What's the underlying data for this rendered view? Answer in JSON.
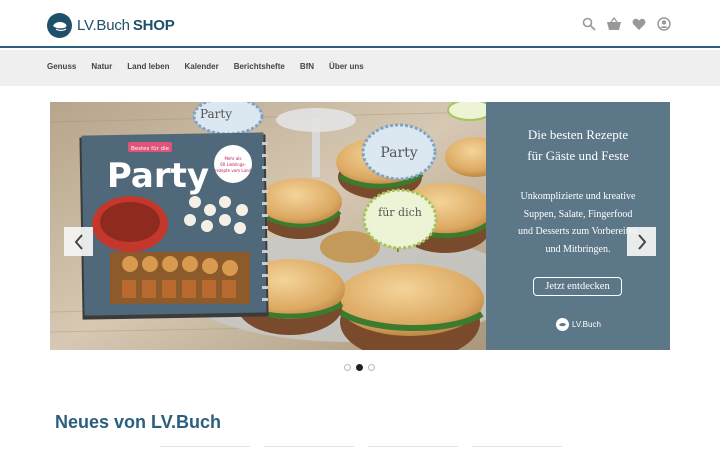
{
  "header": {
    "logo_main": "LV.Buch",
    "logo_shop": "SHOP",
    "icons": [
      "search-icon",
      "basket-icon",
      "heart-icon",
      "account-icon"
    ]
  },
  "nav": {
    "items": [
      {
        "label": "Genuss"
      },
      {
        "label": "Natur"
      },
      {
        "label": "Land leben"
      },
      {
        "label": "Kalender"
      },
      {
        "label": "Berichtshefte"
      },
      {
        "label": "BfN"
      },
      {
        "label": "Über uns"
      }
    ]
  },
  "hero": {
    "book_small_title": "Bestes für die",
    "book_title": "Party",
    "book_badge": "Mehr als 60 Lieblingsrezepte vom Land",
    "flag_1": "Party",
    "flag_2": "Party",
    "flag_3": "für dich",
    "title_line1": "Die besten Rezepte",
    "title_line2": "für Gäste und Feste",
    "text_line1": "Unkomplizierte und kreative",
    "text_line2": "Suppen, Salate, Fingerfood",
    "text_line3": "und Desserts zum Vorbereiten",
    "text_line4": "und Mitbringen.",
    "cta_label": "Jetzt entdecken",
    "panel_logo": "LV.Buch",
    "slides": 3,
    "active_slide": 2
  },
  "section": {
    "title": "Neues von LV.Buch"
  },
  "colors": {
    "brand": "#1f4f69",
    "panel": "#5c7788",
    "nav_bg": "#efefef"
  }
}
